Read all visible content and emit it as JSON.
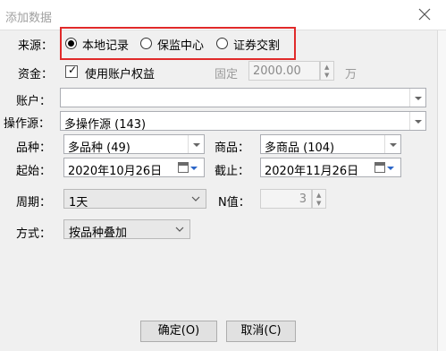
{
  "window": {
    "title": "添加数据"
  },
  "source": {
    "label": "来源：",
    "options": [
      "本地记录",
      "保监中心",
      "证券交割"
    ],
    "selected": "本地记录"
  },
  "fund": {
    "label": "资金：",
    "checkbox_label": "使用账户权益",
    "checked": true,
    "fixed_label": "固定",
    "fixed_value": "2000.00",
    "unit": "万"
  },
  "account": {
    "label": "账户：",
    "value": ""
  },
  "operator": {
    "label": "操作源：",
    "value": "多操作源 (143)"
  },
  "variety": {
    "label": "品种：",
    "value": "多品种 (49)"
  },
  "product": {
    "label": "商品：",
    "value": "多商品 (104)"
  },
  "start": {
    "label": "起始：",
    "value": "2020年10月26日"
  },
  "end": {
    "label": "截止：",
    "value": "2020年11月26日"
  },
  "period": {
    "label": "周期：",
    "value": "1天"
  },
  "nvalue": {
    "label": "N值：",
    "value": "3"
  },
  "mode": {
    "label": "方式：",
    "value": "按品种叠加"
  },
  "buttons": {
    "ok": "确定(O)",
    "cancel": "取消(C)"
  },
  "colors": {
    "highlight": "#e02a2a",
    "accent": "#2c66c8"
  }
}
